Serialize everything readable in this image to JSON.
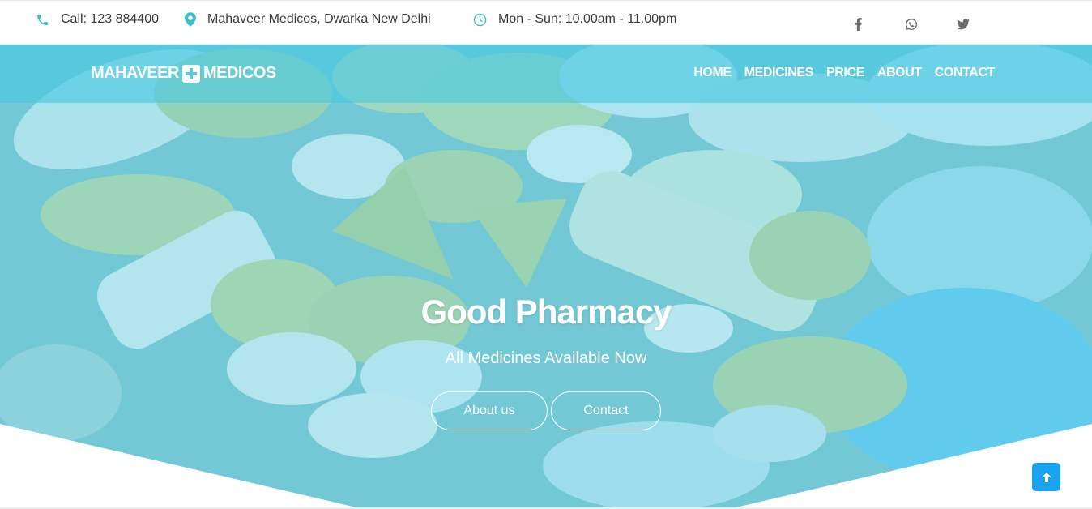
{
  "topbar": {
    "phone": "Call: 123 884400",
    "address": "Mahaveer Medicos, Dwarka New Delhi",
    "hours": "Mon - Sun: 10.00am - 11.00pm",
    "icon_color": "#3bbfcb",
    "social": [
      {
        "icon": "facebook-icon"
      },
      {
        "icon": "whatsapp-icon"
      },
      {
        "icon": "twitter-icon"
      }
    ]
  },
  "brand": {
    "name_left": "MAHAVEER",
    "name_right": "MEDICOS",
    "cross_color": "#5bc8dd"
  },
  "nav": {
    "items": [
      "HOME",
      "MEDICINES",
      "PRICE",
      "ABOUT",
      "CONTACT"
    ]
  },
  "hero": {
    "title": "Good Pharmacy",
    "subtitle": "All Medicines Available Now",
    "buttons": {
      "about": "About us",
      "contact": "Contact"
    },
    "overlay_color": "#40c4e0"
  },
  "scroll_top": {
    "icon": "arrow-up-icon",
    "color": "#1aa3f0"
  }
}
